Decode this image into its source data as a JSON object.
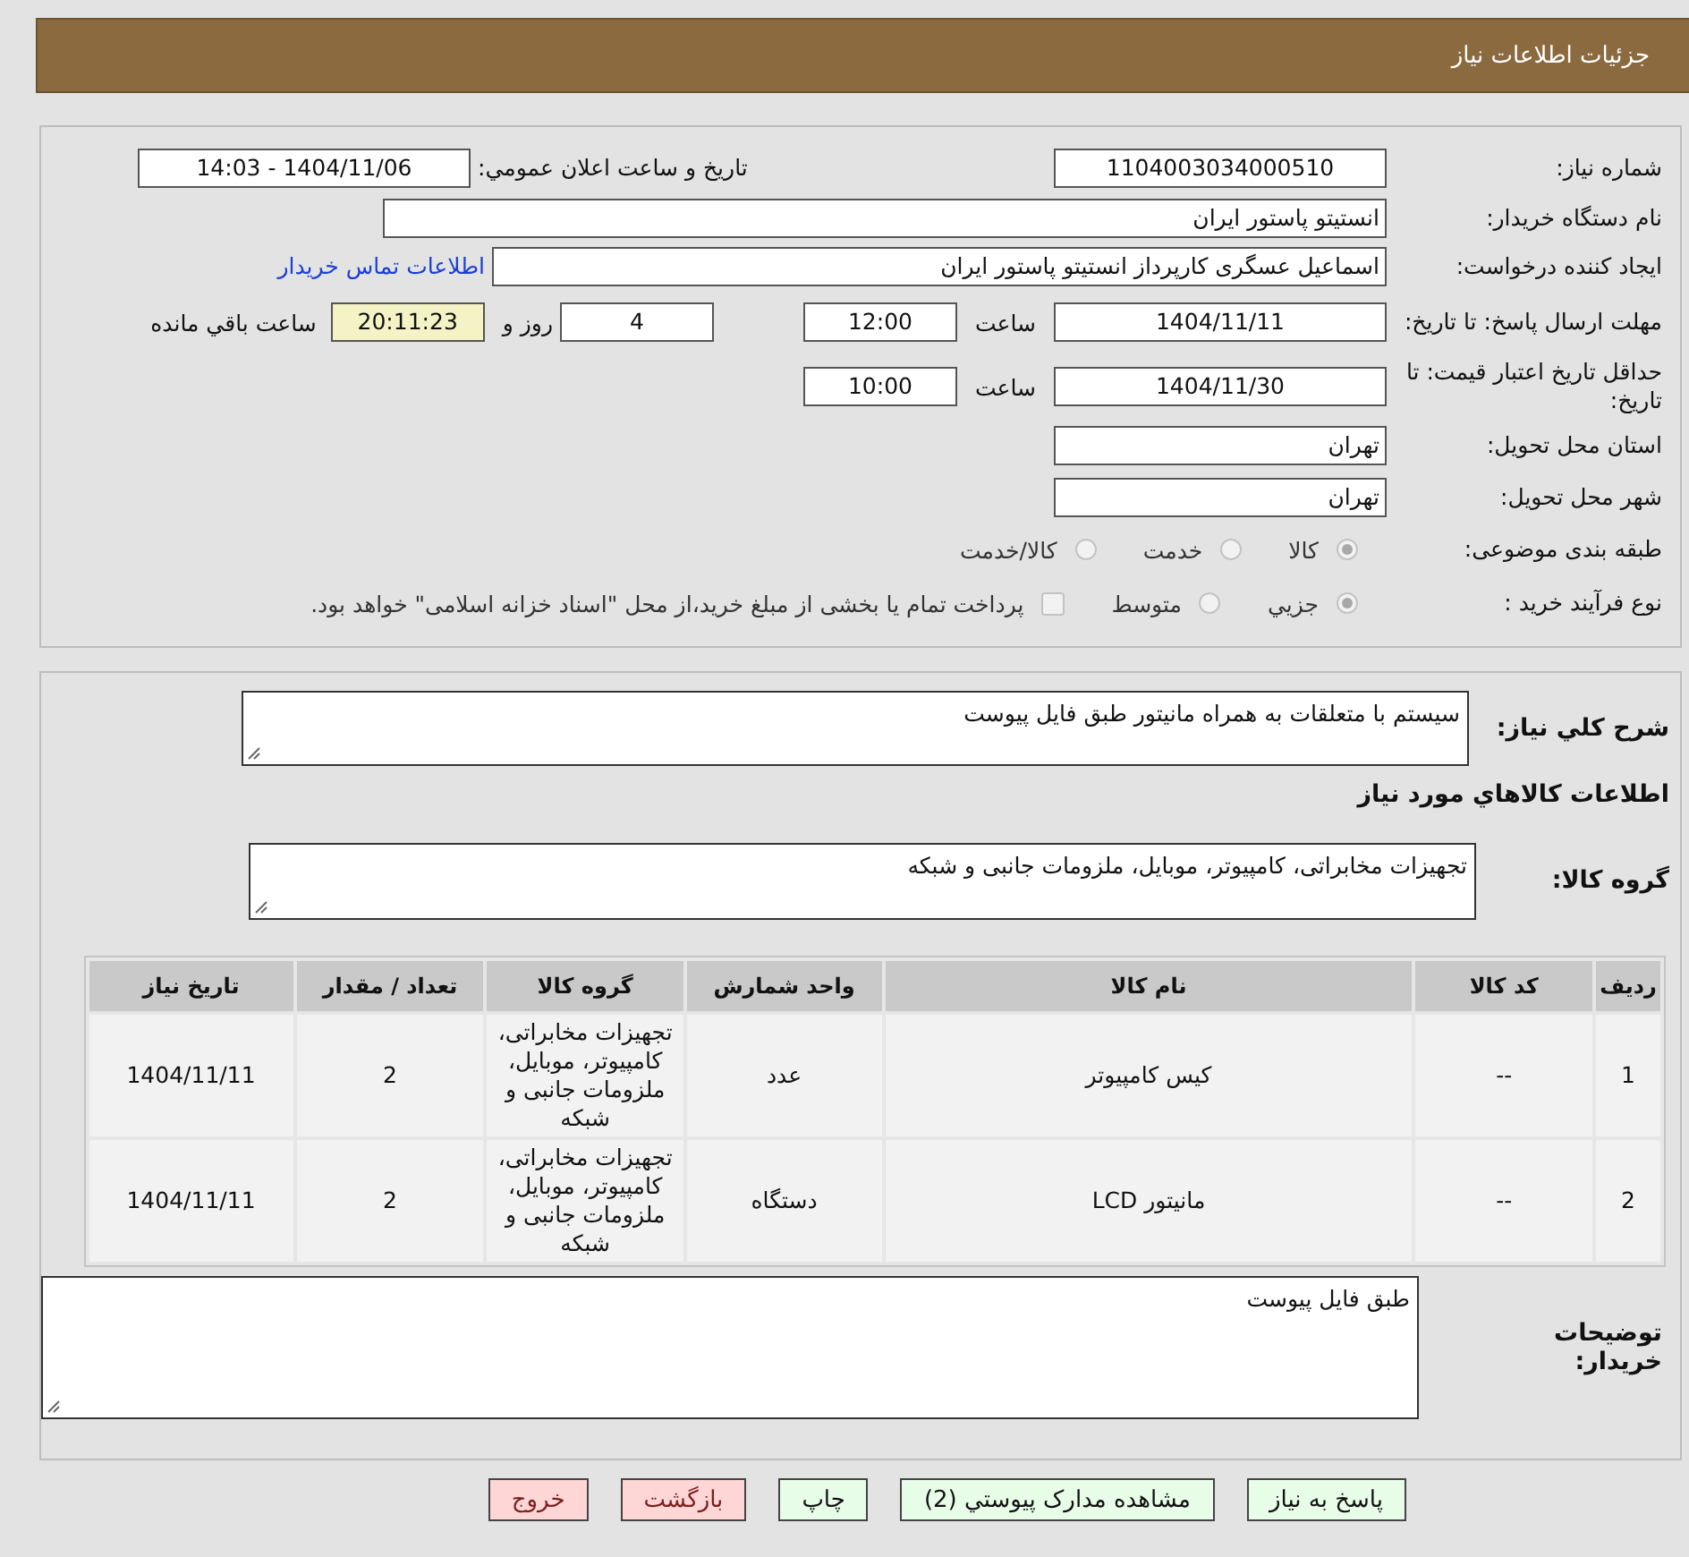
{
  "header": {
    "title": "جزئیات اطلاعات نیاز"
  },
  "details": {
    "need_number": {
      "label": "شماره نیاز:",
      "value": "1104003034000510"
    },
    "announce": {
      "label": "تاریخ و ساعت اعلان عمومي:",
      "value": "1404/11/06 - 14:03"
    },
    "buyer_org": {
      "label": "نام دستگاه خریدار:",
      "value": "انستیتو پاستور ایران"
    },
    "requester": {
      "label": "ایجاد کننده درخواست:",
      "value": "اسماعیل عسگری کارپرداز انستیتو پاستور ایران",
      "link": "اطلاعات تماس خریدار"
    },
    "deadline": {
      "label": "مهلت ارسال پاسخ: تا تاریخ:",
      "date": "1404/11/11",
      "time_label": "ساعت",
      "time": "12:00",
      "days": "4",
      "days_label": "روز و",
      "remaining": "20:11:23",
      "remaining_label": "ساعت باقي مانده"
    },
    "validity": {
      "label": "حداقل تاریخ اعتبار قیمت: تا تاریخ:",
      "date": "1404/11/30",
      "time_label": "ساعت",
      "time": "10:00"
    },
    "province": {
      "label": "استان محل تحویل:",
      "value": "تهران"
    },
    "city": {
      "label": "شهر محل تحویل:",
      "value": "تهران"
    },
    "category": {
      "label": "طبقه بندی موضوعی:",
      "options": [
        {
          "label": "کالا",
          "selected": true
        },
        {
          "label": "خدمت",
          "selected": false
        },
        {
          "label": "کالا/خدمت",
          "selected": false
        }
      ]
    },
    "purchase_type": {
      "label": "نوع فرآیند خرید :",
      "options": [
        {
          "label": "جزيي",
          "selected": true
        },
        {
          "label": "متوسط",
          "selected": false
        }
      ],
      "payment": {
        "label": "پرداخت تمام یا بخشی از مبلغ خرید،از محل \"اسناد خزانه اسلامی\" خواهد بود.",
        "checked": false
      }
    }
  },
  "summary": {
    "description": {
      "label": "شرح کلي نیاز:",
      "value": "سیستم با متعلقات به همراه مانیتور طبق فایل پیوست"
    },
    "goods_title": "اطلاعات کالاهاي مورد نیاز",
    "goods_group": {
      "label": "گروه کالا:",
      "value": "تجهیزات مخابراتی، کامپیوتر، موبایل، ملزومات جانبی و شبکه"
    },
    "table": {
      "columns": [
        "ردیف",
        "کد کالا",
        "نام کالا",
        "واحد شمارش",
        "گروه کالا",
        "تعداد / مقدار",
        "تاریخ نیاز"
      ],
      "rows": [
        [
          "1",
          "--",
          "کیس کامپیوتر",
          "عدد",
          "تجهیزات مخابراتی، کامپیوتر، موبایل، ملزومات جانبی و شبکه",
          "2",
          "1404/11/11"
        ],
        [
          "2",
          "--",
          "مانیتور LCD",
          "دستگاه",
          "تجهیزات مخابراتی، کامپیوتر، موبایل، ملزومات جانبی و شبکه",
          "2",
          "1404/11/11"
        ]
      ]
    },
    "buyer_notes": {
      "label": "توضیحات خریدار:",
      "value": "طبق فایل پیوست"
    }
  },
  "buttons": [
    {
      "label": "پاسخ به نیاز",
      "kind": "action"
    },
    {
      "label": "مشاهده مدارک پیوستي (2)",
      "kind": "action"
    },
    {
      "label": "چاپ",
      "kind": "action"
    },
    {
      "label": "بازگشت",
      "kind": "exit"
    },
    {
      "label": "خروج",
      "kind": "exit"
    }
  ]
}
